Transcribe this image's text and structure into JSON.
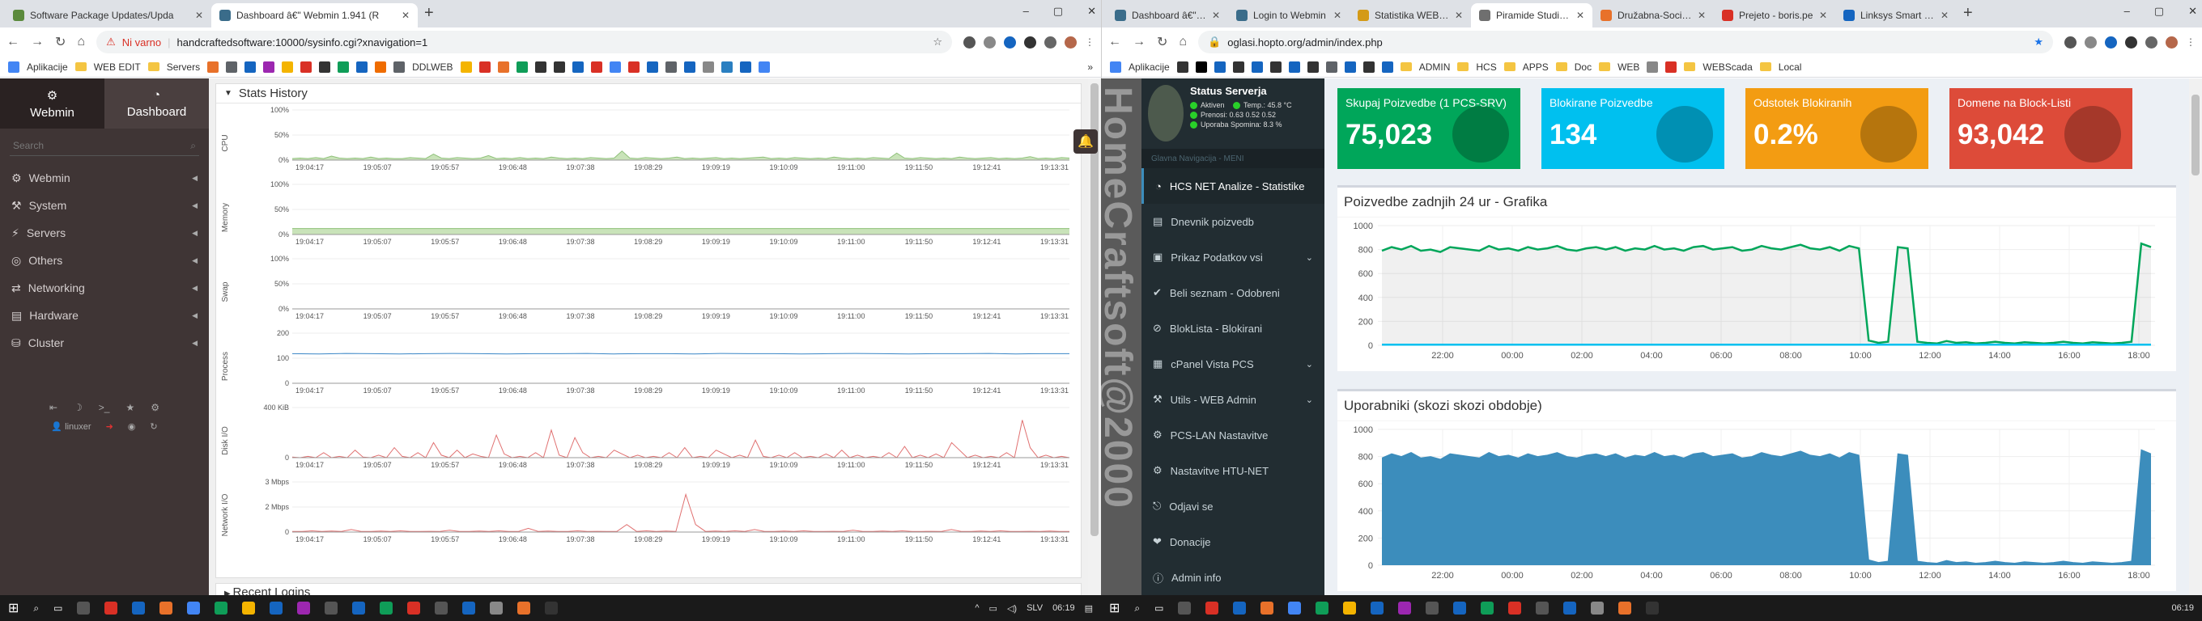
{
  "left": {
    "tabs": [
      {
        "label": "Software Package Updates/Upda",
        "color": "#5b8a3c",
        "active": false
      },
      {
        "label": "Dashboard â€\" Webmin 1.941 (R",
        "color": "#3a6c8a",
        "active": true
      }
    ],
    "address": {
      "security": "Ni varno",
      "url": "handcraftedsoftware:10000/sysinfo.cgi?xnavigation=1"
    },
    "bookmarks": [
      "Aplikacije",
      "WEB EDIT",
      "Servers",
      "DDLWEB"
    ],
    "sidebar": {
      "webmin_label": "Webmin",
      "dashboard_label": "Dashboard",
      "search_placeholder": "Search",
      "menu": [
        {
          "label": "Webmin"
        },
        {
          "label": "System"
        },
        {
          "label": "Servers"
        },
        {
          "label": "Others"
        },
        {
          "label": "Networking"
        },
        {
          "label": "Hardware"
        },
        {
          "label": "Cluster"
        }
      ],
      "user": "linuxer"
    },
    "panel": {
      "title": "Stats History",
      "time_labels": [
        "19:04:17",
        "19:05:07",
        "19:05:57",
        "19:06:48",
        "19:07:38",
        "19:08:29",
        "19:09:19",
        "19:10:09",
        "19:11:00",
        "19:11:50",
        "19:12:41",
        "19:13:31"
      ],
      "charts": [
        {
          "name": "CPU",
          "ticks": [
            "100%",
            "50%",
            "0%"
          ],
          "color": "#8fc17a",
          "fill": "#c9e3b9",
          "series": [
            3,
            4,
            3,
            5,
            3,
            8,
            4,
            3,
            4,
            3,
            6,
            3,
            4,
            3,
            3,
            5,
            4,
            3,
            12,
            4,
            3,
            5,
            4,
            3,
            4,
            9,
            3,
            4,
            3,
            5,
            3,
            4,
            3,
            6,
            4,
            3,
            4,
            3,
            5,
            4,
            3,
            4,
            18,
            4,
            3,
            5,
            4,
            3,
            4,
            6,
            3,
            4,
            3,
            4,
            5,
            3,
            4,
            3,
            4,
            5,
            6,
            3,
            4,
            3,
            5,
            4,
            3,
            4,
            3,
            6,
            4,
            3,
            4,
            3,
            5,
            4,
            3,
            14,
            4,
            3,
            5,
            4,
            3,
            4,
            3,
            6,
            4,
            3,
            4,
            5,
            3,
            4,
            3,
            4,
            7,
            3,
            4,
            3,
            5,
            4
          ]
        },
        {
          "name": "Memory",
          "ticks": [
            "100%",
            "50%",
            "0%"
          ],
          "color": "#8fc17a",
          "fill": "#c9e3b9",
          "series": [
            12,
            12,
            12,
            12,
            12,
            12,
            12,
            12,
            12,
            12,
            12,
            12,
            12,
            12,
            12,
            12,
            12,
            12,
            12,
            12,
            12,
            12,
            12,
            12,
            12,
            12,
            12,
            12,
            12,
            12,
            12,
            12,
            12,
            12,
            12,
            12,
            12,
            12,
            12,
            12
          ]
        },
        {
          "name": "Swap",
          "ticks": [
            "100%",
            "50%",
            "0%"
          ],
          "color": "#8fc17a",
          "fill": "#c9e3b9",
          "series": [
            0,
            0,
            0,
            0,
            0,
            0,
            0,
            0,
            0,
            0,
            0,
            0,
            0,
            0,
            0,
            0,
            0,
            0,
            0,
            0
          ]
        },
        {
          "name": "Process",
          "ticks": [
            "200",
            "100",
            "0"
          ],
          "color": "#3a86c6",
          "fill": "none",
          "series": [
            118,
            117,
            119,
            118,
            117,
            118,
            119,
            118,
            117,
            118,
            118,
            119,
            117,
            118,
            118,
            117,
            119,
            118,
            118,
            117,
            118,
            119,
            118,
            117,
            118,
            118,
            119,
            117,
            118,
            118
          ]
        },
        {
          "name": "Disk I/O",
          "ticks": [
            "400 KiB",
            "0"
          ],
          "color": "#e07070",
          "fill": "none",
          "series": [
            5,
            0,
            10,
            0,
            40,
            0,
            10,
            0,
            60,
            5,
            0,
            20,
            0,
            80,
            10,
            0,
            40,
            0,
            120,
            20,
            0,
            60,
            0,
            30,
            10,
            0,
            180,
            30,
            0,
            10,
            0,
            40,
            0,
            220,
            20,
            0,
            160,
            40,
            0,
            10,
            0,
            60,
            30,
            0,
            20,
            0,
            10,
            0,
            40,
            0,
            80,
            0,
            10,
            0,
            60,
            30,
            0,
            20,
            0,
            140,
            10,
            0,
            20,
            0,
            40,
            0,
            10,
            0,
            30,
            0,
            60,
            0,
            20,
            0,
            10,
            0,
            40,
            0,
            90,
            0,
            20,
            0,
            30,
            0,
            120,
            60,
            0,
            20,
            0,
            10,
            0,
            40,
            0,
            300,
            80,
            0,
            20,
            0,
            10,
            0
          ]
        },
        {
          "name": "Network I/O",
          "ticks": [
            "3 Mbps",
            "2 Mbps",
            "0"
          ],
          "color": "#e07070",
          "fill": "none",
          "series": [
            5,
            5,
            10,
            5,
            8,
            5,
            20,
            5,
            5,
            8,
            5,
            10,
            5,
            5,
            6,
            5,
            15,
            5,
            5,
            8,
            5,
            10,
            5,
            5,
            30,
            5,
            8,
            5,
            5,
            10,
            5,
            6,
            5,
            5,
            60,
            5,
            10,
            5,
            8,
            5,
            300,
            60,
            5,
            8,
            5,
            10,
            5,
            20,
            5,
            5,
            8,
            5,
            10,
            5,
            5,
            6,
            5,
            15,
            5,
            5,
            8,
            5,
            10,
            5,
            5,
            6,
            5,
            20,
            5,
            5,
            8,
            5,
            10,
            5,
            5,
            6,
            5,
            8,
            5,
            5
          ]
        }
      ]
    },
    "recent_title": "Recent Logins"
  },
  "right": {
    "tabs": [
      {
        "label": "Dashboard â€\" We",
        "color": "#3a6c8a",
        "active": false
      },
      {
        "label": "Login to Webmin",
        "color": "#3a6c8a",
        "active": false
      },
      {
        "label": "Statistika WEB Ap",
        "color": "#d49a17",
        "active": false
      },
      {
        "label": "Piramide Studio N",
        "color": "#6f6f6f",
        "active": true
      },
      {
        "label": "Družabna-Socialn",
        "color": "#e8712a",
        "active": false
      },
      {
        "label": "Prejeto - boris.pe",
        "color": "#d93025",
        "active": false
      },
      {
        "label": "Linksys Smart Wi-",
        "color": "#1565c0",
        "active": false
      }
    ],
    "address": {
      "url": "oglasi.hopto.org/admin/index.php"
    },
    "bookmarks": [
      "Aplikacije",
      "ADMIN",
      "HCS",
      "APPS",
      "Doc",
      "WEB",
      "WEBScada",
      "Local"
    ],
    "vertical_text": "HomeCraftsoft@2000",
    "status": {
      "title": "Status Serverja",
      "aktiven": "Aktiven",
      "temp": "Temp.: 45.8 °C",
      "prenosi": "Prenosi: 0.63 0.52 0.52",
      "spomin": "Uporaba Spomina: 8.3 %"
    },
    "nav_header": "Glavna Navigacija - MENI",
    "menu": [
      {
        "label": "HCS NET Analize - Statistike",
        "active": true,
        "sub": false
      },
      {
        "label": "Dnevnik poizvedb",
        "active": false,
        "sub": false
      },
      {
        "label": "Prikaz Podatkov vsi",
        "active": false,
        "sub": true
      },
      {
        "label": "Beli seznam - Odobreni",
        "active": false,
        "sub": false
      },
      {
        "label": "BlokLista - Blokirani",
        "active": false,
        "sub": false
      },
      {
        "label": "cPanel Vista PCS",
        "active": false,
        "sub": true
      },
      {
        "label": "Utils - WEB Admin",
        "active": false,
        "sub": true
      },
      {
        "label": "PCS-LAN Nastavitve",
        "active": false,
        "sub": false
      },
      {
        "label": "Nastavitve HTU-NET",
        "active": false,
        "sub": false
      },
      {
        "label": "Odjavi se",
        "active": false,
        "sub": false
      },
      {
        "label": "Donacije",
        "active": false,
        "sub": false
      },
      {
        "label": "Admin info",
        "active": false,
        "sub": false
      }
    ],
    "boxes": [
      {
        "label": "Skupaj Poizvedbe (1 PCS-SRV)",
        "value": "75,023",
        "color": "#00a65a"
      },
      {
        "label": "Blokirane Poizvedbe",
        "value": "134",
        "color": "#00c0ef"
      },
      {
        "label": "Odstotek Blokiranih",
        "value": "0.2%",
        "color": "#f39c12"
      },
      {
        "label": "Domene na Block-Listi",
        "value": "93,042",
        "color": "#dd4b39"
      }
    ],
    "queries_card": {
      "title": "Poizvedbe zadnjih 24 ur - Grafika",
      "chart_data": {
        "type": "area",
        "xlabels": [
          "22:00",
          "00:00",
          "02:00",
          "04:00",
          "06:00",
          "08:00",
          "10:00",
          "12:00",
          "14:00",
          "16:00",
          "18:00"
        ],
        "yticks": [
          "1000",
          "800",
          "600",
          "400",
          "200",
          "0"
        ],
        "ylim": [
          0,
          1000
        ],
        "series": [
          {
            "color": "#00a65a",
            "values": [
              790,
              820,
              800,
              830,
              790,
              800,
              780,
              820,
              810,
              800,
              790,
              830,
              800,
              810,
              790,
              820,
              800,
              810,
              830,
              800,
              790,
              810,
              820,
              800,
              820,
              790,
              810,
              800,
              830,
              800,
              810,
              790,
              820,
              830,
              800,
              810,
              820,
              790,
              800,
              830,
              810,
              800,
              820,
              840,
              810,
              800,
              820,
              790,
              830,
              810,
              40,
              20,
              30,
              820,
              810,
              30,
              20,
              15,
              35,
              20,
              25,
              15,
              20,
              30,
              20,
              15,
              25,
              20,
              15,
              20,
              30,
              20,
              15,
              25,
              20,
              15,
              20,
              30,
              850,
              820
            ]
          },
          {
            "color": "#00c0ef",
            "values": [
              5,
              5,
              5,
              5,
              5,
              5,
              5,
              5,
              5,
              5,
              5,
              5,
              5,
              5,
              5,
              5,
              5,
              5,
              5,
              5,
              5,
              5,
              5,
              5,
              5,
              5,
              5,
              5,
              5,
              5,
              5,
              5,
              5,
              5,
              5,
              5,
              5,
              5,
              5,
              5,
              5,
              5,
              5,
              5,
              5,
              5,
              5,
              5,
              5,
              5,
              5,
              5,
              5,
              5,
              5,
              5,
              5,
              5,
              5,
              5,
              5,
              5,
              5,
              5,
              5,
              5,
              5,
              5,
              5,
              5,
              5,
              5,
              5,
              5,
              5,
              5,
              5,
              5,
              5,
              5
            ]
          }
        ]
      }
    },
    "users_card": {
      "title": "Uporabniki (skozi skozi obdobje)",
      "chart_data": {
        "type": "area",
        "xlabels": [
          "22:00",
          "00:00",
          "02:00",
          "04:00",
          "06:00",
          "08:00",
          "10:00",
          "12:00",
          "14:00",
          "16:00",
          "18:00"
        ],
        "yticks": [
          "1000",
          "800",
          "600",
          "400",
          "200",
          "0"
        ],
        "ylim": [
          0,
          1000
        ],
        "series": [
          {
            "color": "#3c8dbc",
            "values": [
              790,
              820,
              800,
              830,
              790,
              800,
              780,
              820,
              810,
              800,
              790,
              830,
              800,
              810,
              790,
              820,
              800,
              810,
              830,
              800,
              790,
              810,
              820,
              800,
              820,
              790,
              810,
              800,
              830,
              800,
              810,
              790,
              820,
              830,
              800,
              810,
              820,
              790,
              800,
              830,
              810,
              800,
              820,
              840,
              810,
              800,
              820,
              790,
              830,
              810,
              40,
              20,
              30,
              820,
              810,
              30,
              20,
              15,
              35,
              20,
              25,
              15,
              20,
              30,
              20,
              15,
              25,
              20,
              15,
              20,
              30,
              20,
              15,
              25,
              20,
              15,
              20,
              30,
              850,
              820
            ]
          }
        ]
      }
    }
  },
  "taskbar": {
    "lang": "SLV",
    "time": "06:19"
  }
}
